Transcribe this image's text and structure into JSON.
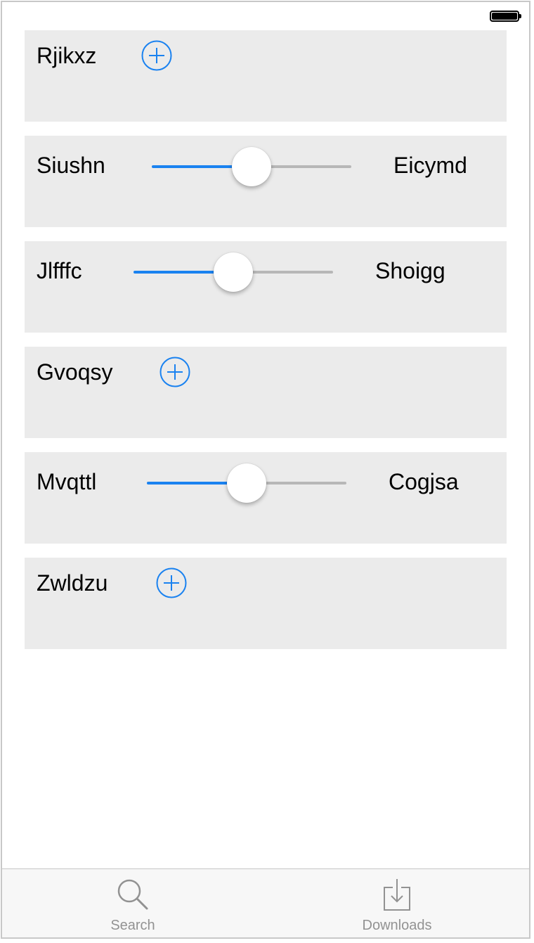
{
  "colors": {
    "accent": "#1a82f0",
    "row_background": "#ebebeb",
    "track_max": "#b7b7b7",
    "tab_inactive": "#929292"
  },
  "rows": [
    {
      "type": "add",
      "label": "Rjikxz",
      "icon": "plus-circle-icon"
    },
    {
      "type": "slider",
      "label": "Siushn",
      "right_label": "Eicymd",
      "value": 0.5
    },
    {
      "type": "slider",
      "label": "Jlfffc",
      "right_label": "Shoigg",
      "value": 0.5
    },
    {
      "type": "add",
      "label": "Gvoqsy",
      "icon": "plus-circle-icon"
    },
    {
      "type": "slider",
      "label": "Mvqttl",
      "right_label": "Cogjsa",
      "value": 0.5
    },
    {
      "type": "add",
      "label": "Zwldzu",
      "icon": "plus-circle-icon"
    }
  ],
  "tabbar": {
    "tabs": [
      {
        "label": "Search",
        "icon": "search-icon"
      },
      {
        "label": "Downloads",
        "icon": "download-icon"
      }
    ]
  }
}
